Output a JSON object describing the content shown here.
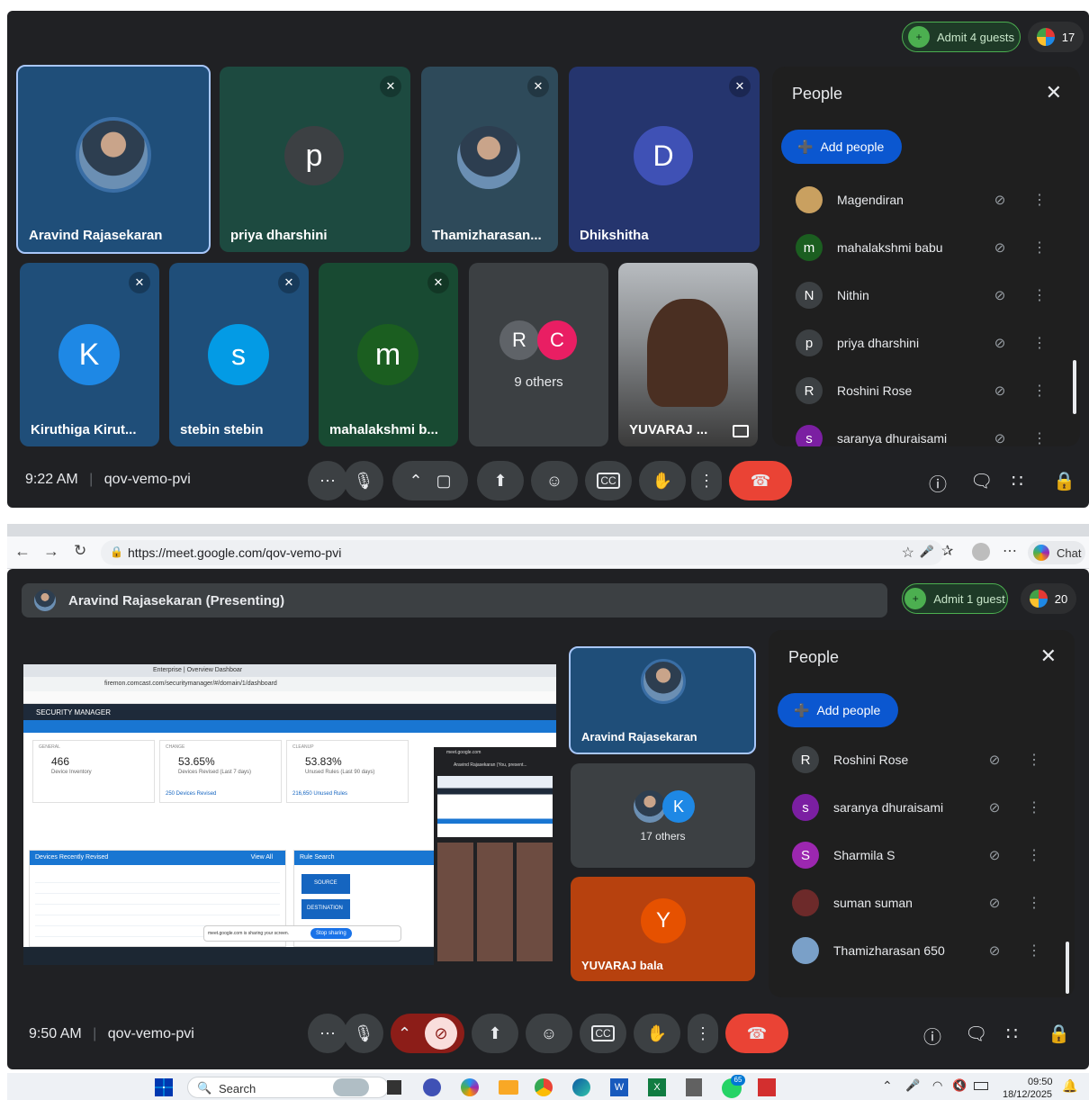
{
  "top": {
    "admit_label": "Admit 4 guests",
    "participant_count": "17",
    "time": "9:22 AM",
    "meeting_code": "qov-vemo-pvi",
    "tiles": [
      {
        "name": "Aravind Rajasekaran"
      },
      {
        "name": "priya dharshini",
        "initial": "p"
      },
      {
        "name": "Thamizharasan..."
      },
      {
        "name": "Dhikshitha",
        "initial": "D"
      },
      {
        "name": "Kiruthiga Kirut...",
        "initial": "K"
      },
      {
        "name": "stebin stebin",
        "initial": "s"
      },
      {
        "name": "mahalakshmi b...",
        "initial": "m"
      },
      {
        "name": "9 others",
        "initials": [
          "R",
          "C"
        ]
      },
      {
        "name": "YUVARAJ ..."
      }
    ],
    "people_panel": {
      "title": "People",
      "add_label": "Add people",
      "people": [
        {
          "name": "Magendiran",
          "initial": "",
          "color": "#c9a060"
        },
        {
          "name": "mahalakshmi babu",
          "initial": "m",
          "color": "#1b5e20"
        },
        {
          "name": "Nithin",
          "initial": "N",
          "color": "#3c4043"
        },
        {
          "name": "priya dharshini",
          "initial": "p",
          "color": "#3c4043"
        },
        {
          "name": "Roshini Rose",
          "initial": "R",
          "color": "#3c4043"
        },
        {
          "name": "saranya dhuraisami",
          "initial": "s",
          "color": "#7b1fa2"
        }
      ]
    }
  },
  "browser": {
    "url": "https://meet.google.com/qov-vemo-pvi",
    "chat_label": "Chat"
  },
  "bottom": {
    "presenter_label": "Aravind Rajasekaran (Presenting)",
    "admit_label": "Admit 1 guest",
    "participant_count": "20",
    "time": "9:50 AM",
    "meeting_code": "qov-vemo-pvi",
    "side_tiles": [
      {
        "name": "Aravind Rajasekaran"
      },
      {
        "name": "17 others",
        "initial": "K"
      },
      {
        "name": "YUVARAJ bala",
        "initial": "Y"
      }
    ],
    "shared_screen": {
      "url": "firemon.comcast.com/securitymanager/#/domain/1/dashboard",
      "app_title": "SECURITY MANAGER",
      "tab_label": "Enterprise | Overview Dashboar",
      "cards": [
        {
          "label": "GENERAL",
          "value": "466",
          "sub": "Device Inventory"
        },
        {
          "label": "CHANGE",
          "value": "53.65%",
          "sub": "Devices Revised (Last 7 days)",
          "link": "250 Devices Revised"
        },
        {
          "label": "CLEANUP",
          "value": "53.83%",
          "sub": "Unused Rules (Last 90 days)",
          "link": "216,650 Unused Rules"
        }
      ],
      "devices_header": "Devices Recently Revised",
      "view_all": "View All",
      "rule_search": "Rule Search",
      "source_label": "SOURCE",
      "destination_label": "DESTINATION",
      "stop_sharing": "Stop sharing",
      "sharing_notice": "meet.google.com is sharing your screen.",
      "meet_mini_title": "meet.google.com",
      "meet_mini_presenter": "Aravind Rajasekaran (You, present..."
    },
    "people_panel": {
      "title": "People",
      "add_label": "Add people",
      "people": [
        {
          "name": "Roshini Rose",
          "initial": "R",
          "color": "#3c4043"
        },
        {
          "name": "saranya dhuraisami",
          "initial": "s",
          "color": "#7b1fa2"
        },
        {
          "name": "Sharmila S",
          "initial": "S",
          "color": "#9c27b0"
        },
        {
          "name": "suman suman",
          "initial": "",
          "color": "#6d2a2a"
        },
        {
          "name": "Thamizharasan 650",
          "initial": "",
          "color": "#7aa0c8"
        }
      ]
    }
  },
  "taskbar": {
    "search_label": "Search",
    "clock_time": "09:50",
    "clock_date": "18/12/2025",
    "badge_count": "65"
  }
}
